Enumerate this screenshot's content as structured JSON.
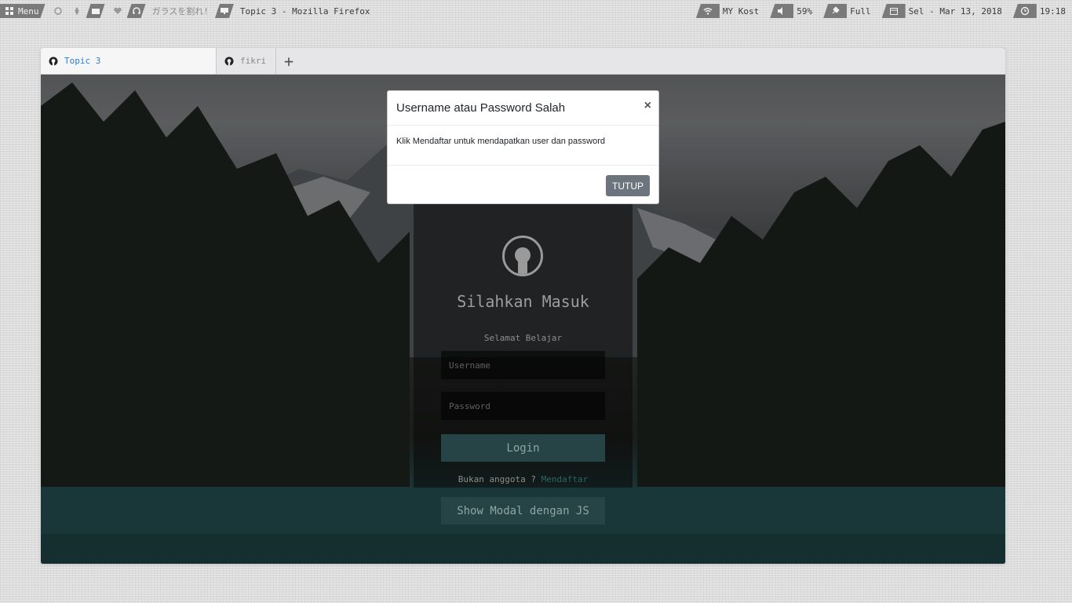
{
  "panel": {
    "menu_label": "Menu",
    "app_text": "ガラスを割れ!",
    "window_title": "Topic 3 - Mozilla Firefox",
    "wifi_label": "MY Kost",
    "volume_label": "59%",
    "battery_label": "Full",
    "date_label": "Sel - Mar 13, 2018",
    "time_label": "19:18"
  },
  "browser": {
    "tabs": [
      {
        "label": "Topic 3",
        "icon": "github-icon"
      },
      {
        "label": "fikri",
        "icon": "github-icon"
      }
    ],
    "new_tab_symbol": "+"
  },
  "login": {
    "title": "Silahkan Masuk",
    "subtitle": "Selamat Belajar",
    "username_placeholder": "Username",
    "password_placeholder": "Password",
    "login_button": "Login",
    "member_text": "Bukan anggota ?",
    "register_link": "Mendaftar",
    "show_modal_button": "Show Modal dengan JS"
  },
  "modal": {
    "title": "Username atau Password Salah",
    "close_symbol": "×",
    "body": "Klik Mendaftar untuk mendapatkan user dan password",
    "close_button": "TUTUP"
  },
  "colors": {
    "accent_tab": "#2a7fd4",
    "button_teal": "#264345",
    "modal_button": "#6c757d"
  }
}
